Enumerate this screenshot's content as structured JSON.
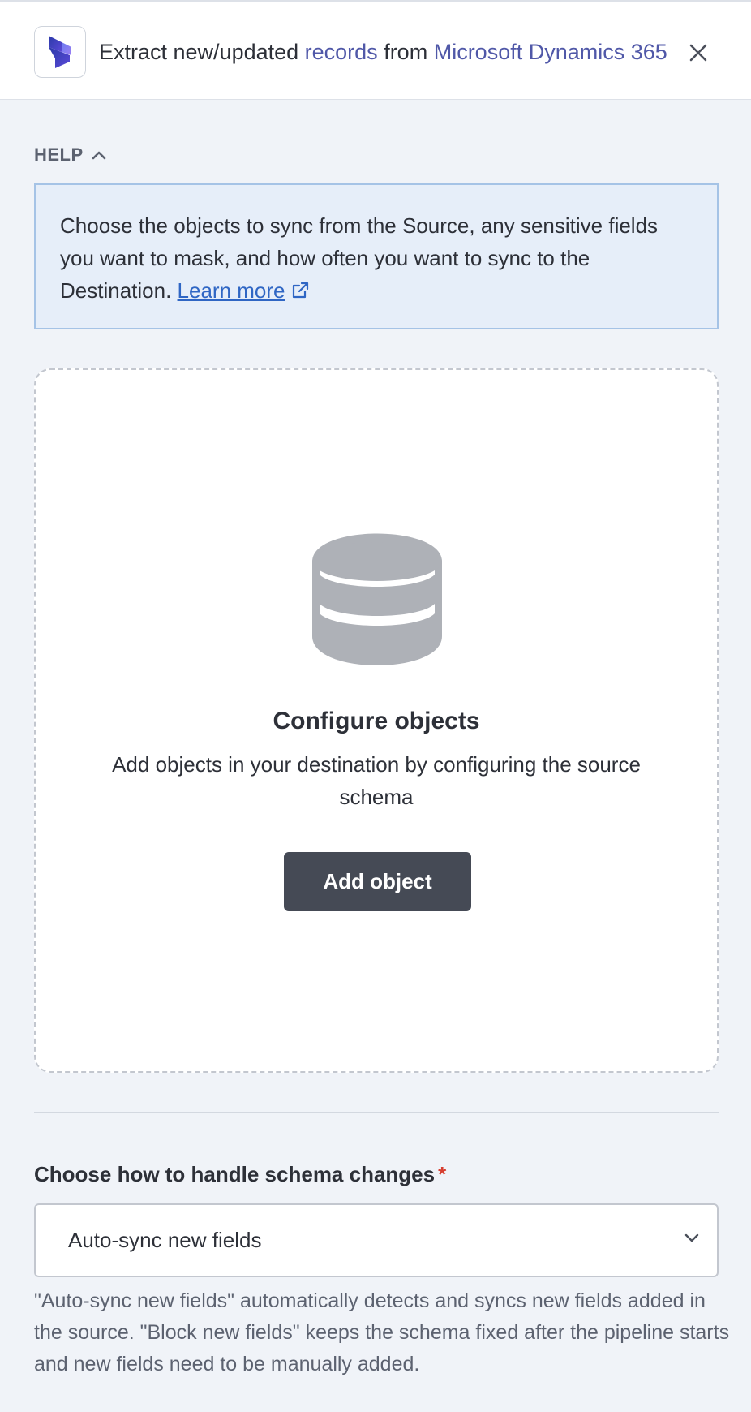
{
  "header": {
    "title_prefix": "Extract new/updated ",
    "title_link1": "records",
    "title_mid": " from ",
    "title_link2": "Microsoft Dynamics 365",
    "logo_icon": "dynamics-365-logo",
    "close_icon": "close-icon"
  },
  "help": {
    "toggle_label": "HELP",
    "body_text": "Choose the objects to sync from the Source, any sensitive fields you want to mask, and how often you want to sync to the Destination. ",
    "learn_more": "Learn more"
  },
  "config": {
    "icon": "database-icon",
    "title": "Configure objects",
    "description": "Add objects in your destination by configuring the source schema",
    "add_button": "Add object"
  },
  "schema": {
    "label": "Choose how to handle schema changes",
    "required_mark": "*",
    "selected_value": "Auto-sync new fields",
    "help_text": "\"Auto-sync new fields\" automatically detects and syncs new fields added in the source. \"Block new fields\" keeps the schema fixed after the pipeline starts and new fields need to be manually added."
  },
  "colors": {
    "accent_link": "#5058a8",
    "help_bg": "#e6eef9",
    "help_border": "#a5c3e6",
    "button_bg": "#454a55",
    "required": "#d63d2f"
  }
}
